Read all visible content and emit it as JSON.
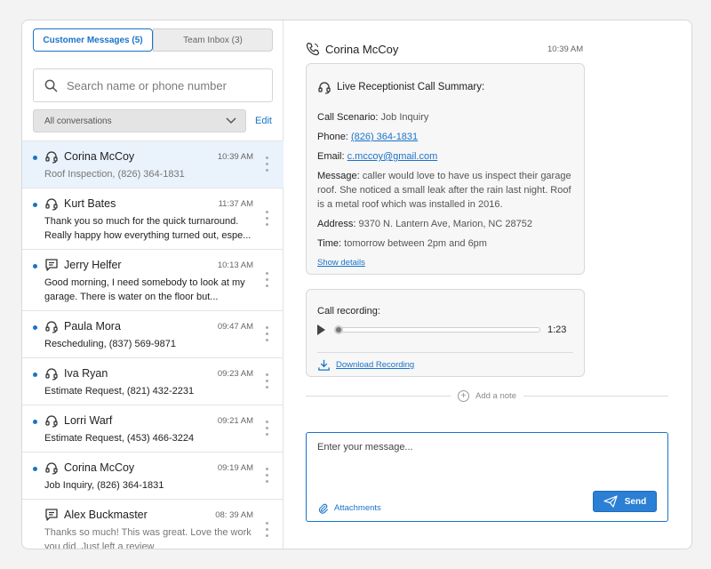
{
  "tabs": [
    {
      "label": "Customer Messages (5)",
      "active": true
    },
    {
      "label": "Team Inbox (3)",
      "active": false
    }
  ],
  "search": {
    "placeholder": "Search name or phone number",
    "value": ""
  },
  "filter": {
    "selected": "All conversations",
    "edit_label": "Edit"
  },
  "conversations": [
    {
      "name": "Corina McCoy",
      "time": "10:39 AM",
      "preview": "Roof Inspection, (826) 364-1831",
      "icon": "headset-icon",
      "unread": true,
      "selected": true
    },
    {
      "name": "Kurt Bates",
      "time": "11:37 AM",
      "preview": "Thank you so much for the quick turnaround. Really happy how everything turned out, espe...",
      "icon": "headset-icon",
      "unread": true
    },
    {
      "name": "Jerry Helfer",
      "time": "10:13 AM",
      "preview": "Good morning, I need somebody to look at my garage. There is water on the floor but...",
      "icon": "chat-icon",
      "unread": true
    },
    {
      "name": "Paula Mora",
      "time": "09:47 AM",
      "preview": "Rescheduling, (837) 569-9871",
      "icon": "headset-icon",
      "unread": true
    },
    {
      "name": "Iva Ryan",
      "time": "09:23 AM",
      "preview": "Estimate Request, (821) 432-2231",
      "icon": "headset-icon",
      "unread": true
    },
    {
      "name": "Lorri Warf",
      "time": "09:21 AM",
      "preview": "Estimate Request, (453) 466-3224",
      "icon": "headset-icon",
      "unread": true
    },
    {
      "name": "Corina McCoy",
      "time": "09:19 AM",
      "preview": "Job Inquiry, (826) 364-1831",
      "icon": "headset-icon",
      "unread": true
    },
    {
      "name": "Alex Buckmaster",
      "time": "08: 39 AM",
      "preview": "Thanks so much! This was great. Love the work you did. Just left a review",
      "icon": "chat-icon",
      "unread": false
    }
  ],
  "chat": {
    "name": "Corina McCoy",
    "time": "10:39 AM",
    "summary": {
      "title": "Live Receptionist Call Summary:",
      "scenario_label": "Call Scenario:",
      "scenario": "Job Inquiry",
      "phone_label": "Phone:",
      "phone": "(826) 364-1831",
      "email_label": "Email:",
      "email": "c.mccoy@gmail.com",
      "message_label": "Message:",
      "message": "caller would love to have us inspect their garage roof. She noticed a small leak after the rain last night. Roof is a metal roof which was installed in 2016.",
      "address_label": "Address:",
      "address": "9370 N. Lantern Ave, Marion, NC 28752",
      "time_label": "Time:",
      "time": "tomorrow between 2pm and 6pm",
      "show_details": "Show details"
    },
    "recording": {
      "label": "Call recording:",
      "duration": "1:23",
      "progress": 0,
      "download_label": "Download Recording"
    },
    "add_note": "Add a note",
    "composer": {
      "placeholder": "Enter your message...",
      "attachments_label": "Attachments",
      "send_label": "Send"
    }
  },
  "colors": {
    "accent": "#1a73c9",
    "selected_row": "#eaf3fc",
    "send_button": "#2b7fd4"
  }
}
